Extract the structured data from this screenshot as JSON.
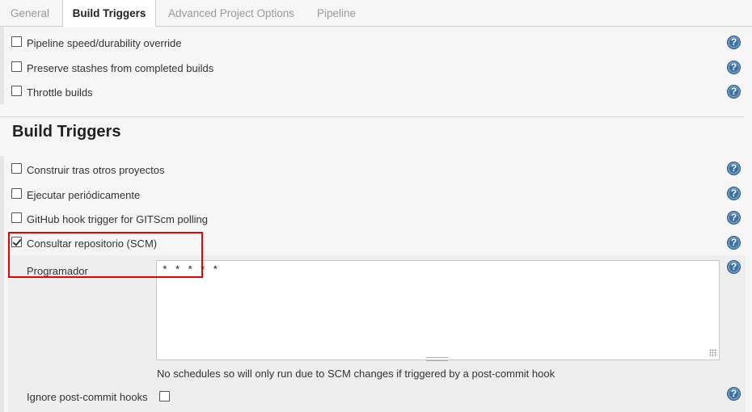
{
  "tabs": [
    {
      "label": "General",
      "active": false
    },
    {
      "label": "Build Triggers",
      "active": true
    },
    {
      "label": "Advanced Project Options",
      "active": false
    },
    {
      "label": "Pipeline",
      "active": false
    }
  ],
  "options_top": [
    {
      "label": "Pipeline speed/durability override",
      "checked": false
    },
    {
      "label": "Preserve stashes from completed builds",
      "checked": false
    },
    {
      "label": "Throttle builds",
      "checked": false
    }
  ],
  "section": {
    "title": "Build Triggers"
  },
  "triggers": [
    {
      "label": "Construir tras otros proyectos",
      "checked": false
    },
    {
      "label": "Ejecutar periódicamente",
      "checked": false
    },
    {
      "label": "GitHub hook trigger for GITScm polling",
      "checked": false
    },
    {
      "label": "Consultar repositorio (SCM)",
      "checked": true
    }
  ],
  "scm": {
    "schedule_label": "Programador",
    "schedule_value": "* * * * *",
    "hint": "No schedules so will only run due to SCM changes if triggered by a post-commit hook",
    "ignore_hooks_label": "Ignore post-commit hooks",
    "ignore_hooks_checked": false
  },
  "help_icon_text": "?",
  "colors": {
    "highlight": "#e00000",
    "help": "#3e6f9d"
  }
}
